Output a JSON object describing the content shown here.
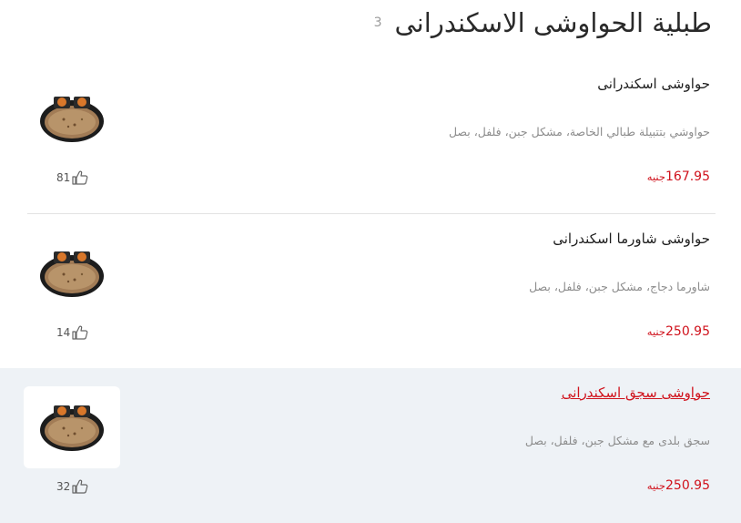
{
  "section": {
    "title": "طبلية الحواوشى الاسكندرانى",
    "count": "3"
  },
  "items": [
    {
      "name": "حواوشى اسكندرانى",
      "description": "حواوشي بتتبيلة طبالي الخاصة، مشكل جبن، فلفل، بصل",
      "price": "167.95",
      "currency": "جنيه",
      "likes": "81"
    },
    {
      "name": "حواوشى شاورما اسكندرانى",
      "description": "شاورما دجاج، مشكل جبن، فلفل، بصل",
      "price": "250.95",
      "currency": "جنيه",
      "likes": "14"
    },
    {
      "name": "حواوشى سجق اسكندرانى",
      "description": "سجق بلدى مع مشكل جبن، فلفل، بصل",
      "price": "250.95",
      "currency": "جنيه",
      "likes": "32"
    }
  ],
  "colors": {
    "price": "#d0121c",
    "active_row_bg": "#eef2f6"
  },
  "icons": {
    "like": "thumbs-up-icon",
    "dish": "hawawshi-platter-image"
  }
}
